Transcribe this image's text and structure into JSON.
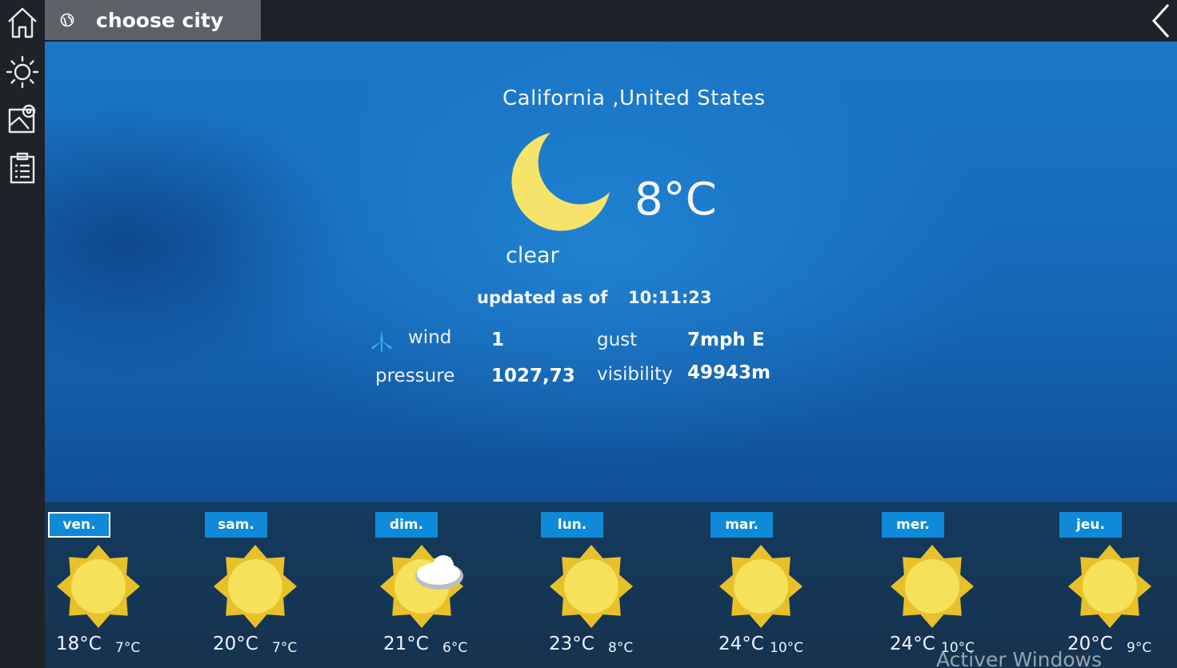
{
  "topbar": {
    "city_button_label": "choose city"
  },
  "nav": {
    "items": [
      "home",
      "weather",
      "map",
      "list"
    ]
  },
  "current": {
    "location": "California ,United States",
    "temperature": "8°C",
    "condition": "clear",
    "updated_label": "updated as of",
    "updated_time": "10:11:23",
    "details": {
      "wind_label": "wind",
      "wind_value": "1",
      "gust_label": "gust",
      "gust_value": "7mph E",
      "pressure_label": "pressure",
      "pressure_value": "1027,73",
      "visibility_label": "visibility",
      "visibility_value": "49943m"
    }
  },
  "forecast": [
    {
      "day": "ven.",
      "high": "18°C",
      "low": "7°C",
      "icon": "sun-icon",
      "selected": true
    },
    {
      "day": "sam.",
      "high": "20°C",
      "low": "7°C",
      "icon": "sun-icon"
    },
    {
      "day": "dim.",
      "high": "21°C",
      "low": "6°C",
      "icon": "sun-cloud-icon"
    },
    {
      "day": "lun.",
      "high": "23°C",
      "low": "8°C",
      "icon": "sun-icon"
    },
    {
      "day": "mar.",
      "high": "24°C",
      "low": "10°C",
      "icon": "sun-icon"
    },
    {
      "day": "mer.",
      "high": "24°C",
      "low": "10°C",
      "icon": "sun-icon"
    },
    {
      "day": "jeu.",
      "high": "20°C",
      "low": "9°C",
      "icon": "sun-icon"
    }
  ],
  "watermark": "Activer Windows",
  "colors": {
    "accent": "#0e8ad9",
    "moon": "#f6e46a",
    "sun": "#f5d43a",
    "panel": "#1565b4"
  }
}
